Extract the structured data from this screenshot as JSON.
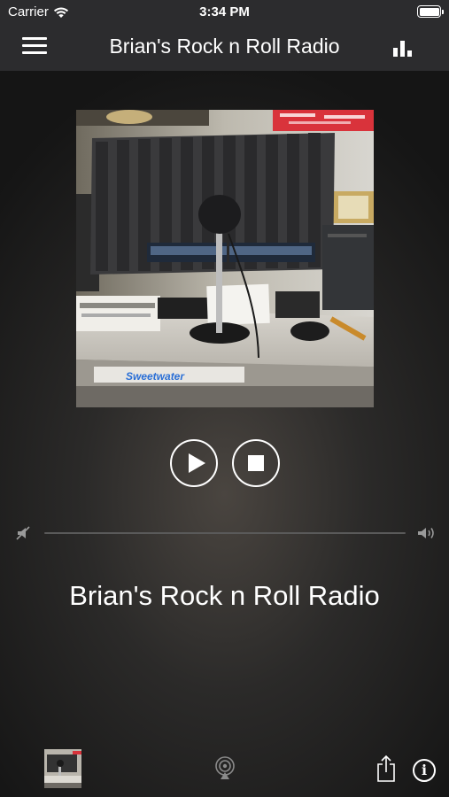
{
  "status_bar": {
    "carrier": "Carrier",
    "time": "3:34 PM",
    "icons": [
      "wifi-icon",
      "battery-icon"
    ]
  },
  "nav": {
    "title": "Brian's Rock n Roll Radio",
    "icons": [
      "menu-icon",
      "equalizer-icon"
    ]
  },
  "album_art": {
    "sticker_text": "Sweetwater",
    "description_icon": "studio-microphone-photo"
  },
  "controls": {
    "icons": [
      "play-icon",
      "stop-icon"
    ]
  },
  "volume": {
    "level": 0,
    "icons": [
      "volume-mute-icon",
      "volume-max-icon"
    ]
  },
  "station": {
    "name": "Brian's Rock n Roll Radio"
  },
  "bottom_bar": {
    "icons": [
      "album-thumbnail",
      "airplay-icon",
      "share-icon",
      "info-icon"
    ]
  },
  "colors": {
    "bar_background": "#2c2c2e",
    "foreground": "#ffffff",
    "sticker_blue": "#2a6fd6"
  }
}
